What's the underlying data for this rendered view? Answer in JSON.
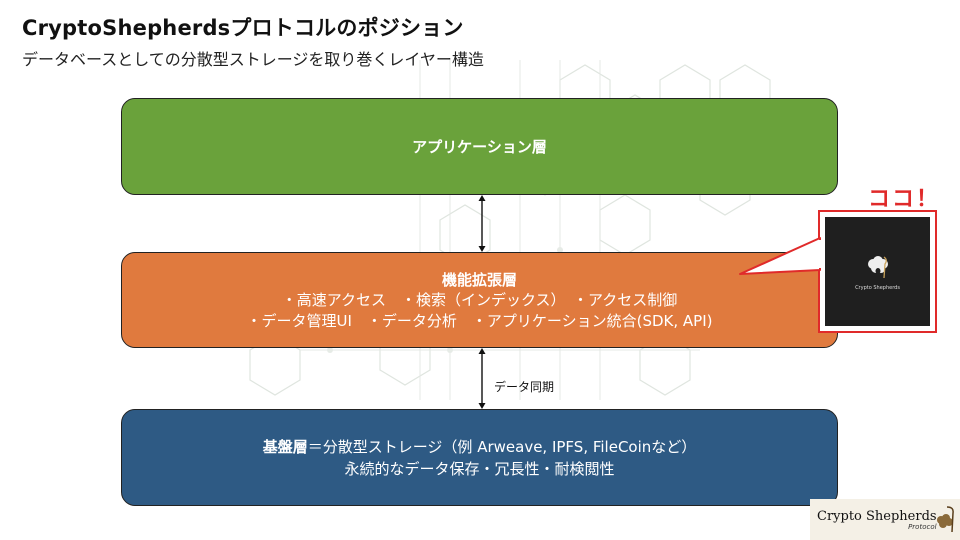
{
  "header": {
    "title": "CryptoShepherdsプロトコルのポジション",
    "subtitle": "データベースとしての分散型ストレージを取り巻くレイヤー構造"
  },
  "layers": {
    "application": {
      "title": "アプリケーション層"
    },
    "functional": {
      "title": "機能拡張層",
      "line1": "・高速アクセス　・検索（インデックス）　・アクセス制御",
      "line2": "・データ管理UI　・データ分析　・アプリケーション統合(SDK, API)"
    },
    "base": {
      "title": "基盤層",
      "line1_rest": "＝分散型ストレージ（例 Arweave, IPFS, FileCoinなど）",
      "line2": "永続的なデータ保存・冗長性・耐検閲性"
    }
  },
  "connectors": {
    "sync_label": "データ同期"
  },
  "callout": {
    "label": "ココ！",
    "logo_text": "Crypto Shepherds"
  },
  "brand": {
    "name": "Crypto Shepherds",
    "sub": "Protocol"
  },
  "colors": {
    "application": "#6aa23b",
    "functional": "#e07a3e",
    "base": "#2e5a84",
    "callout_accent": "#e02a2a"
  }
}
